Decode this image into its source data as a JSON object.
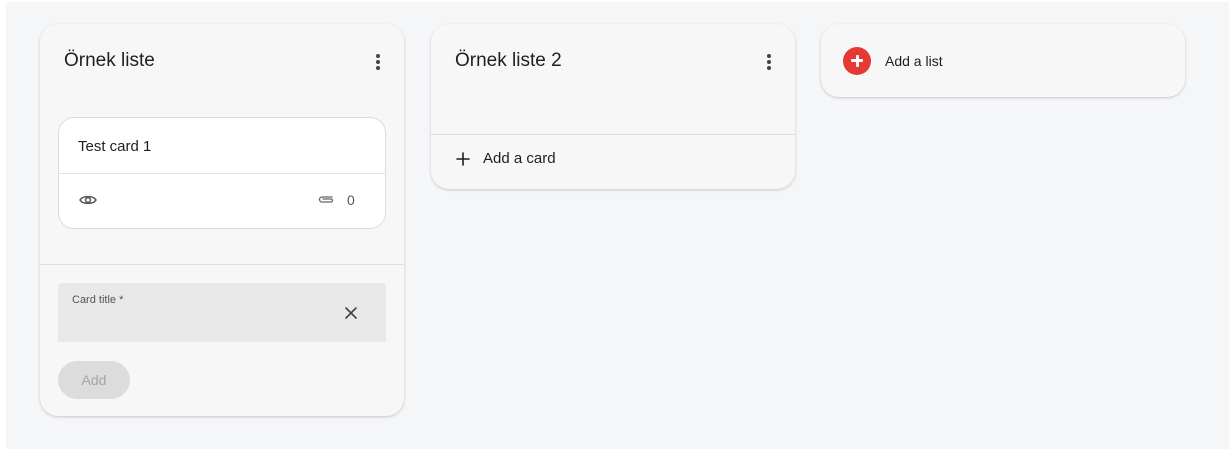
{
  "lists": [
    {
      "title": "Örnek liste",
      "cards": [
        {
          "title": "Test card 1",
          "attachments": "0"
        }
      ],
      "composer": {
        "label": "Card title *",
        "value": "",
        "add_label": "Add"
      }
    },
    {
      "title": "Örnek liste 2",
      "add_card_label": "Add a card"
    }
  ],
  "add_list": {
    "label": "Add a list",
    "accent": "#e53935"
  }
}
